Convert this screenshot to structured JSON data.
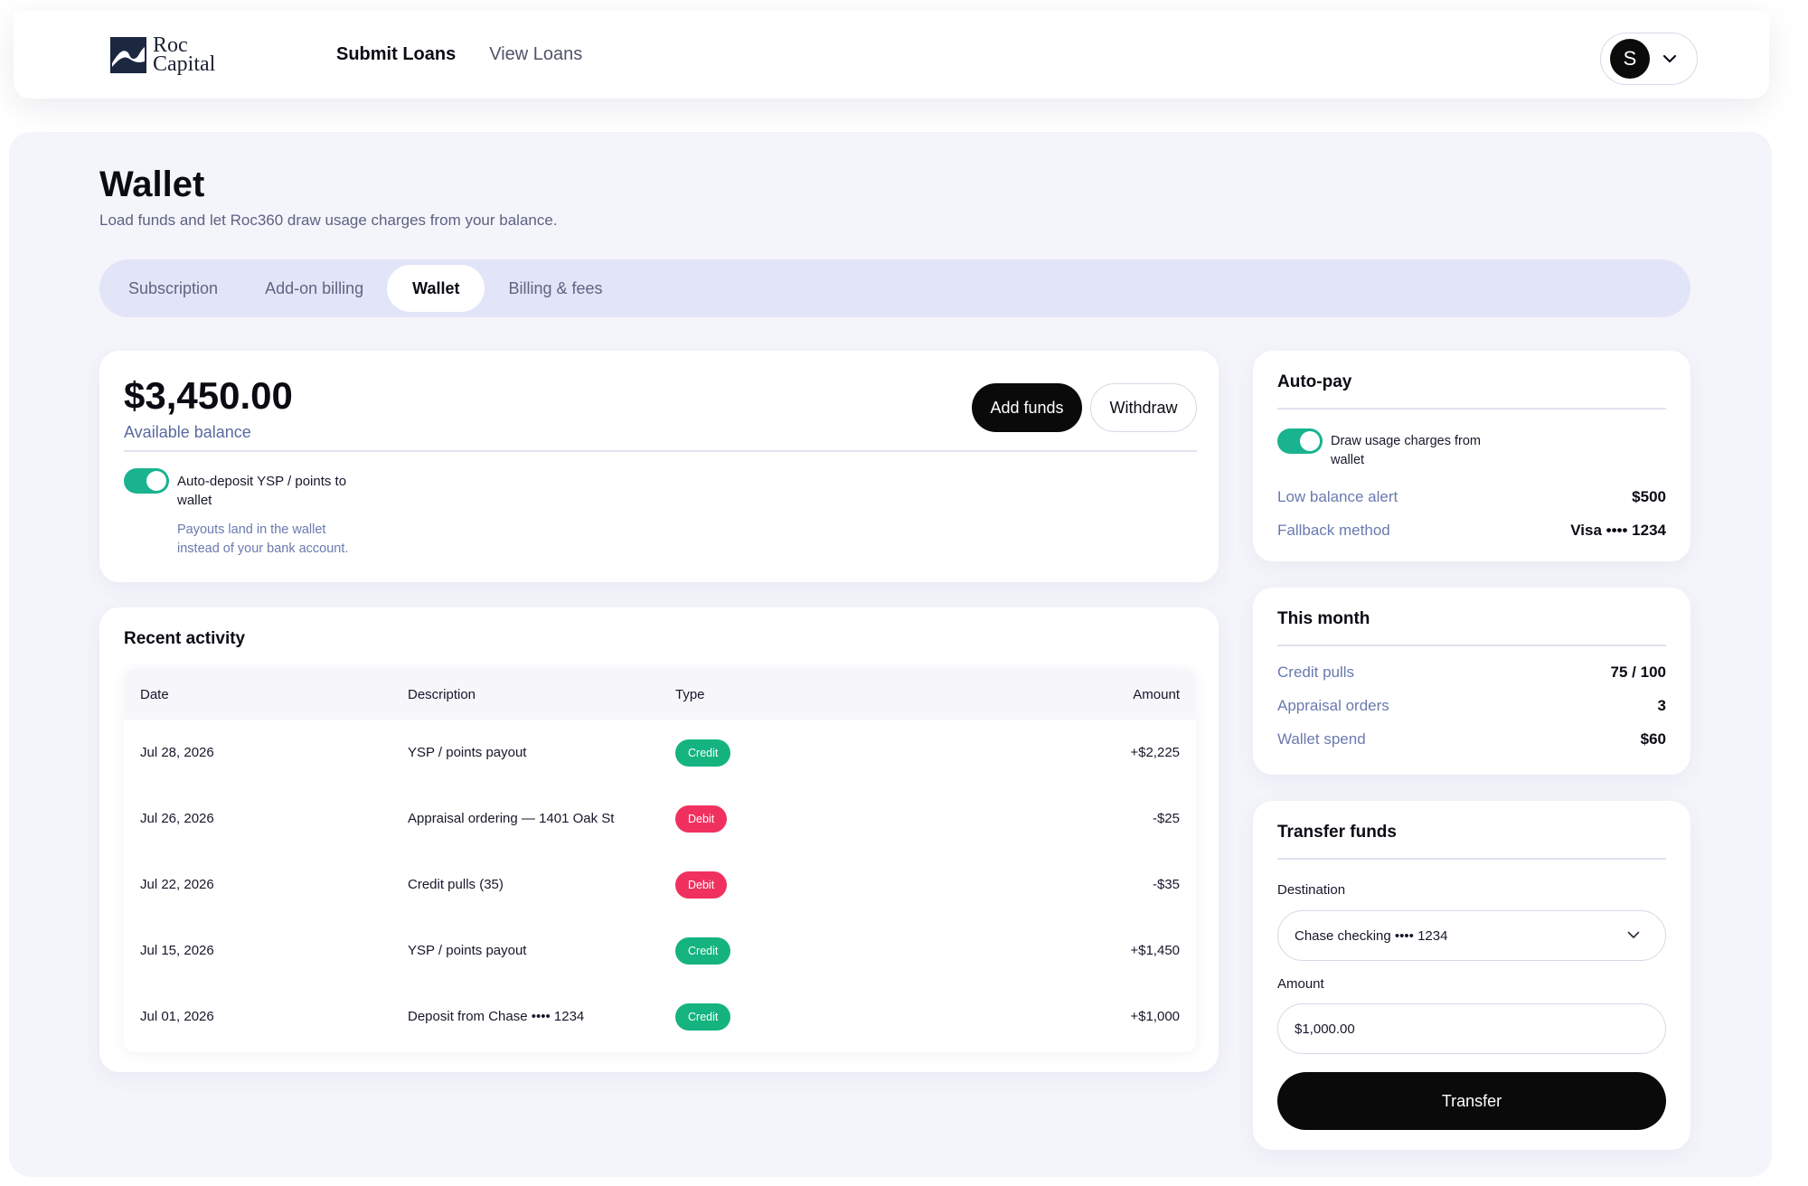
{
  "header": {
    "logo": {
      "line1": "Roc",
      "line2": "Capital",
      "icon": "roc-capital-wave-logo"
    },
    "nav": [
      {
        "label": "Submit Loans",
        "active": true
      },
      {
        "label": "View Loans",
        "active": false
      }
    ],
    "user": {
      "initial": "S",
      "menu_icon": "chevron-down-icon"
    }
  },
  "page": {
    "title": "Wallet",
    "subtitle": "Load funds and let Roc360 draw usage charges from your balance."
  },
  "tabs": [
    {
      "label": "Subscription",
      "active": false
    },
    {
      "label": "Add-on billing",
      "active": false
    },
    {
      "label": "Wallet",
      "active": true
    },
    {
      "label": "Billing & fees",
      "active": false
    }
  ],
  "balance": {
    "amount": "$3,450.00",
    "label": "Available balance",
    "add_funds_label": "Add funds",
    "withdraw_label": "Withdraw",
    "auto_deposit": {
      "enabled": true,
      "label_line1": "Auto-deposit YSP / points to",
      "label_line2": "wallet",
      "help_line1": "Payouts land in the wallet",
      "help_line2": "instead of your bank account."
    }
  },
  "activity": {
    "title": "Recent activity",
    "columns": {
      "date": "Date",
      "description": "Description",
      "type": "Type",
      "amount": "Amount"
    },
    "rows": [
      {
        "date": "Jul 28, 2026",
        "description": "YSP / points payout",
        "type": "Credit",
        "amount": "+$2,225"
      },
      {
        "date": "Jul 26, 2026",
        "description": "Appraisal ordering — 1401 Oak St",
        "type": "Debit",
        "amount": "-$25"
      },
      {
        "date": "Jul 22, 2026",
        "description": "Credit pulls (35)",
        "type": "Debit",
        "amount": "-$35"
      },
      {
        "date": "Jul 15, 2026",
        "description": "YSP / points payout",
        "type": "Credit",
        "amount": "+$1,450"
      },
      {
        "date": "Jul 01, 2026",
        "description": "Deposit from Chase •••• 1234",
        "type": "Credit",
        "amount": "+$1,000"
      }
    ]
  },
  "autopay": {
    "title": "Auto-pay",
    "toggle_enabled": true,
    "toggle_label_line1": "Draw usage charges from",
    "toggle_label_line2": "wallet",
    "low_balance_label": "Low balance alert",
    "low_balance_value": "$500",
    "fallback_label": "Fallback method",
    "fallback_value": "Visa •••• 1234"
  },
  "this_month": {
    "title": "This month",
    "items": [
      {
        "label": "Credit pulls",
        "value": "75 / 100"
      },
      {
        "label": "Appraisal orders",
        "value": "3"
      },
      {
        "label": "Wallet spend",
        "value": "$60"
      }
    ]
  },
  "transfer": {
    "title": "Transfer funds",
    "destination_label": "Destination",
    "destination_value": "Chase checking •••• 1234",
    "amount_label": "Amount",
    "amount_value": "$1,000.00",
    "button_label": "Transfer"
  },
  "colors": {
    "accent_dark": "#0a0a0a",
    "toggle_on": "#19b38e",
    "credit_badge": "#15b37f",
    "debit_badge": "#f0315f",
    "tab_track": "#e2e5f7",
    "page_bg": "#f4f4fb"
  }
}
